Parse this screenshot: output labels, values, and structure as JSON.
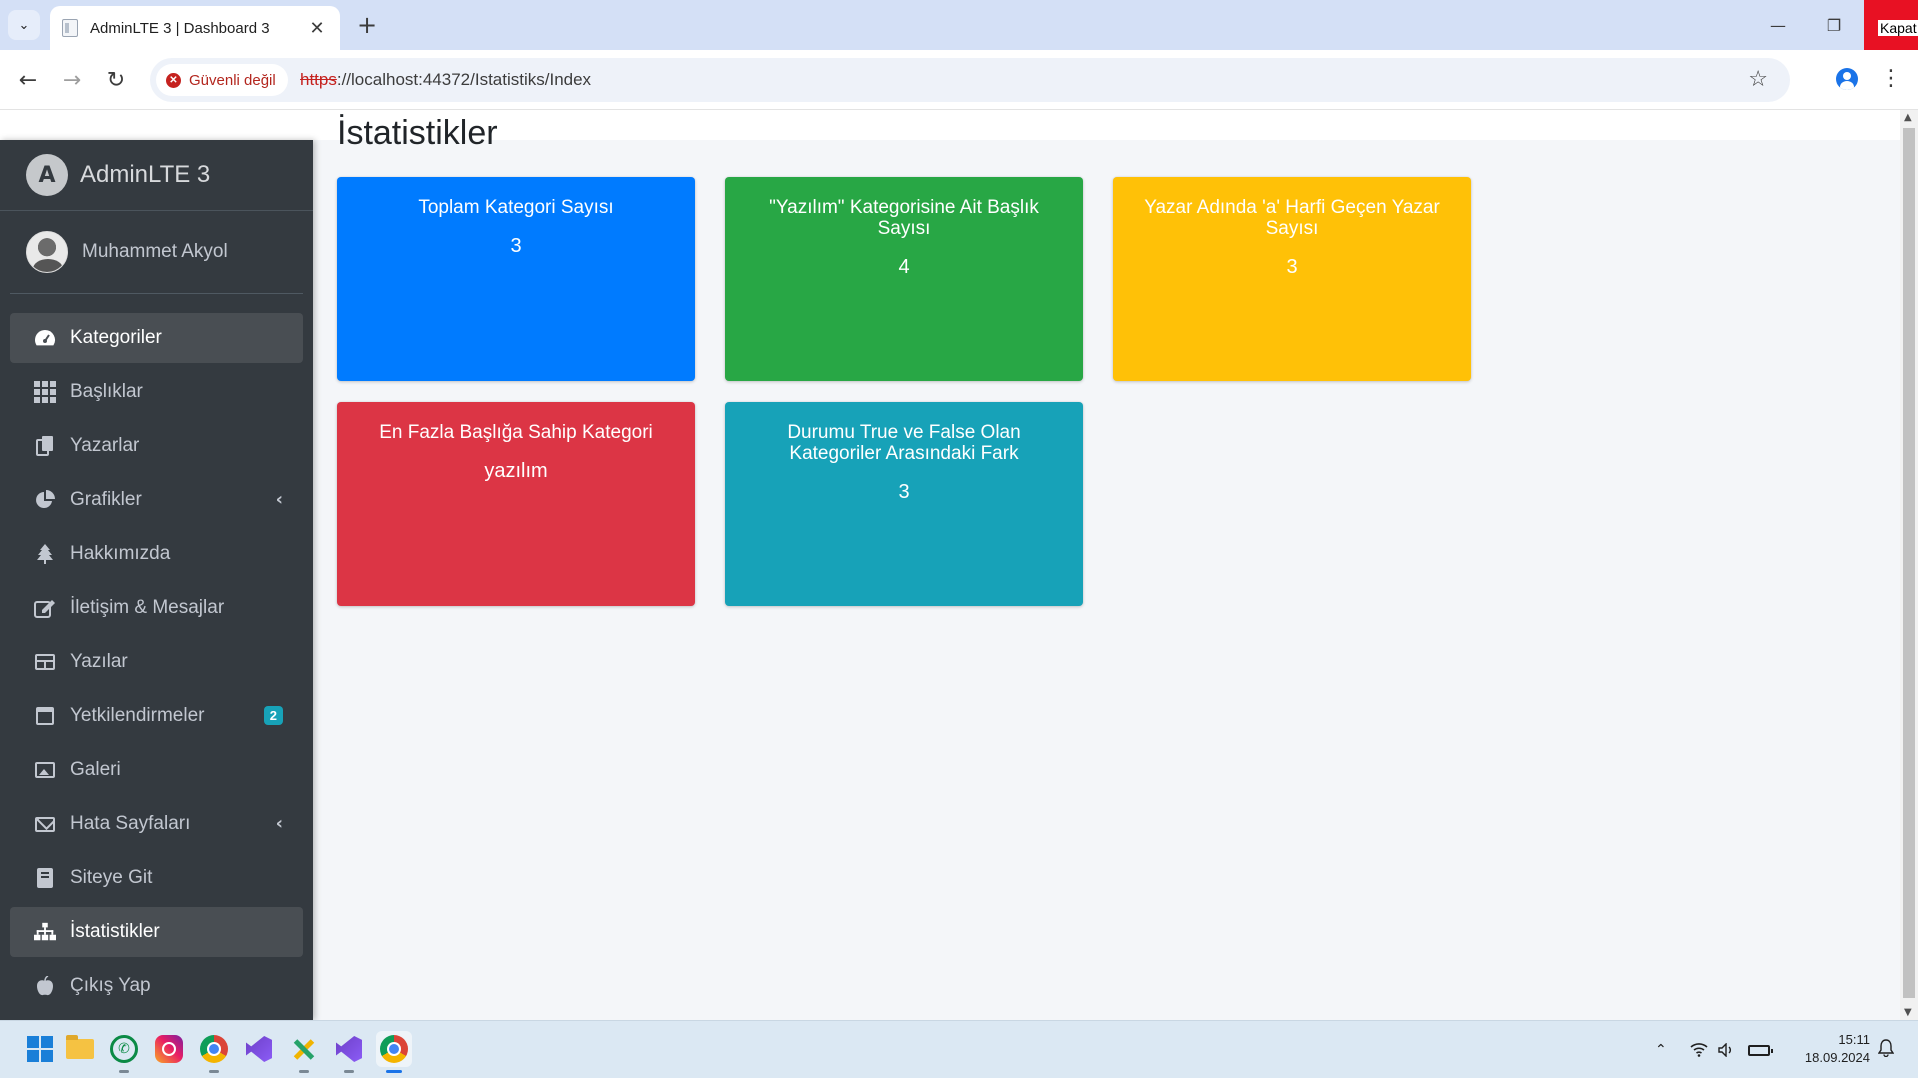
{
  "browser": {
    "tab_title": "AdminLTE 3 | Dashboard 3",
    "security_label": "Güvenli değil",
    "url_scheme": "https",
    "url_rest": "://localhost:44372/Istatistiks/Index",
    "close_tooltip": "Kapat"
  },
  "sidebar": {
    "brand": "AdminLTE 3",
    "user_name": "Muhammet Akyol",
    "items": [
      {
        "label": "Kategoriler",
        "icon": "tachometer-icon",
        "active": true
      },
      {
        "label": "Başlıklar",
        "icon": "th-grid-icon"
      },
      {
        "label": "Yazarlar",
        "icon": "copy-icon"
      },
      {
        "label": "Grafikler",
        "icon": "chart-pie-icon",
        "chevron": true
      },
      {
        "label": "Hakkımızda",
        "icon": "tree-icon"
      },
      {
        "label": "İletişim & Mesajlar",
        "icon": "edit-icon"
      },
      {
        "label": "Yazılar",
        "icon": "table-icon"
      },
      {
        "label": "Yetkilendirmeler",
        "icon": "calendar-icon",
        "badge": "2"
      },
      {
        "label": "Galeri",
        "icon": "image-icon"
      },
      {
        "label": "Hata Sayfaları",
        "icon": "envelope-icon",
        "chevron": true
      },
      {
        "label": "Siteye Git",
        "icon": "book-icon"
      },
      {
        "label": "İstatistikler",
        "icon": "sitemap-icon",
        "active": true
      },
      {
        "label": "Çıkış Yap",
        "icon": "apple-icon"
      }
    ]
  },
  "main": {
    "title": "İstatistikler",
    "boxes": [
      {
        "label": "Toplam Kategori Sayısı",
        "value": "3",
        "color": "#007bff"
      },
      {
        "label": "\"Yazılım\" Kategorisine Ait Başlık Sayısı",
        "value": "4",
        "color": "#28a745"
      },
      {
        "label": "Yazar Adında 'a' Harfi Geçen Yazar Sayısı",
        "value": "3",
        "color": "#ffc107"
      },
      {
        "label": "En Fazla Başlığa Sahip Kategori",
        "value": "yazılım",
        "color": "#dc3545"
      },
      {
        "label": "Durumu True ve False Olan Kategoriler Arasındaki Fark",
        "value": "3",
        "color": "#17a2b8"
      }
    ]
  },
  "taskbar": {
    "apps": [
      "start-icon",
      "file-explorer-icon",
      "whatsapp-icon",
      "instagram-icon",
      "chrome-icon",
      "visual-studio-icon",
      "tools-icon",
      "visual-studio-icon",
      "chrome-icon"
    ],
    "time": "15:11",
    "date": "18.09.2024"
  }
}
